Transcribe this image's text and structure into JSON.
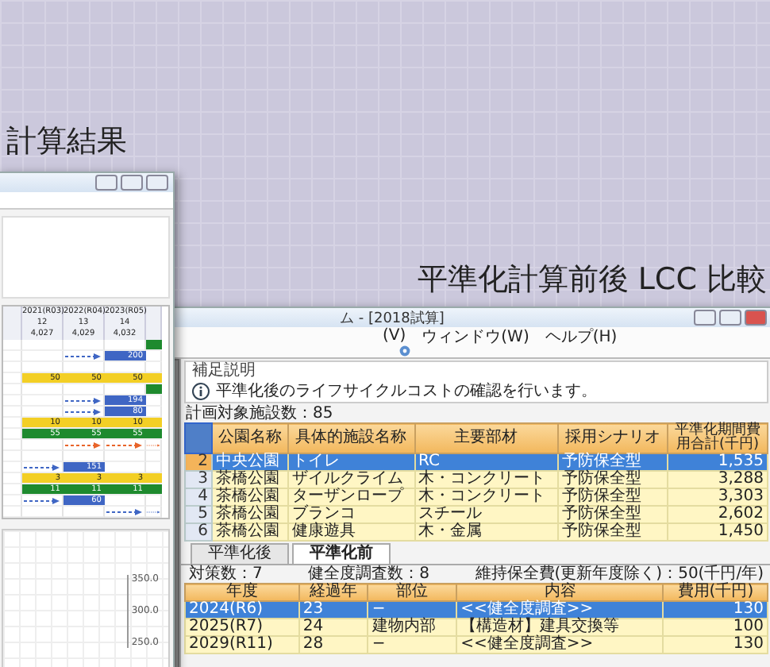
{
  "left_caption": "計算結果",
  "right_caption": "平準化計算前後 LCC 比較",
  "left_window": {
    "grid": {
      "columns": [
        "2021(R03)",
        "2022(R04)",
        "2023(R05)"
      ],
      "column_numbers": [
        "12",
        "13",
        "14"
      ],
      "column_totals": [
        "4,027",
        "4,029",
        "4,032"
      ],
      "rows": [
        {
          "cells": [
            {
              "kind": "empty"
            },
            {
              "kind": "empty"
            },
            {
              "kind": "empty"
            },
            {
              "kind": "done"
            }
          ]
        },
        {
          "cells": [
            {
              "kind": "empty"
            },
            {
              "kind": "arrow"
            },
            {
              "kind": "bar",
              "text": "200"
            },
            {
              "kind": "empty"
            }
          ]
        },
        {
          "cells": [
            {
              "kind": "empty"
            },
            {
              "kind": "empty"
            },
            {
              "kind": "empty"
            },
            {
              "kind": "empty"
            }
          ]
        },
        {
          "cells": [
            {
              "kind": "plan",
              "text": "50"
            },
            {
              "kind": "plan",
              "text": "50"
            },
            {
              "kind": "plan",
              "text": "50"
            },
            {
              "kind": "plan"
            }
          ]
        },
        {
          "cells": [
            {
              "kind": "empty"
            },
            {
              "kind": "empty"
            },
            {
              "kind": "empty"
            },
            {
              "kind": "done"
            }
          ]
        },
        {
          "cells": [
            {
              "kind": "empty"
            },
            {
              "kind": "arrow"
            },
            {
              "kind": "bar",
              "text": "194"
            },
            {
              "kind": "empty"
            }
          ]
        },
        {
          "cells": [
            {
              "kind": "empty"
            },
            {
              "kind": "arrow"
            },
            {
              "kind": "bar",
              "text": "80"
            },
            {
              "kind": "empty"
            }
          ]
        },
        {
          "cells": [
            {
              "kind": "plan",
              "text": "10"
            },
            {
              "kind": "plan",
              "text": "10"
            },
            {
              "kind": "plan",
              "text": "10"
            },
            {
              "kind": "plan"
            }
          ]
        },
        {
          "cells": [
            {
              "kind": "done",
              "text": "55"
            },
            {
              "kind": "done",
              "text": "55"
            },
            {
              "kind": "done",
              "text": "55"
            },
            {
              "kind": "done"
            }
          ]
        },
        {
          "cells": [
            {
              "kind": "empty"
            },
            {
              "kind": "late"
            },
            {
              "kind": "late"
            },
            {
              "kind": "late"
            }
          ]
        },
        {
          "cells": [
            {
              "kind": "empty"
            },
            {
              "kind": "empty"
            },
            {
              "kind": "empty"
            },
            {
              "kind": "empty"
            }
          ]
        },
        {
          "cells": [
            {
              "kind": "arrow"
            },
            {
              "kind": "bar",
              "text": "151"
            },
            {
              "kind": "empty"
            },
            {
              "kind": "empty"
            }
          ]
        },
        {
          "cells": [
            {
              "kind": "plan",
              "text": "3"
            },
            {
              "kind": "plan",
              "text": "3"
            },
            {
              "kind": "plan",
              "text": "3"
            },
            {
              "kind": "plan"
            }
          ]
        },
        {
          "cells": [
            {
              "kind": "done",
              "text": "11"
            },
            {
              "kind": "done",
              "text": "11"
            },
            {
              "kind": "done",
              "text": "11"
            },
            {
              "kind": "done"
            }
          ]
        },
        {
          "cells": [
            {
              "kind": "arrow"
            },
            {
              "kind": "bar",
              "text": "60"
            },
            {
              "kind": "empty"
            },
            {
              "kind": "empty"
            }
          ]
        },
        {
          "cells": [
            {
              "kind": "empty"
            },
            {
              "kind": "empty"
            },
            {
              "kind": "arrow"
            },
            {
              "kind": "arrow"
            }
          ]
        }
      ]
    },
    "chart": {
      "tick_labels": [
        "350.0",
        "300.0",
        "250.0"
      ]
    }
  },
  "right_window": {
    "title": "ム - [2018試算]",
    "menu": [
      "(V)",
      "ウィンドウ(W)",
      "ヘルプ(H)"
    ],
    "note_header": "補足説明",
    "note_text": "平準化後のライフサイクルコストの確認を行います。",
    "facility_count": "計画対象施設数：85",
    "table": {
      "columns": [
        "公園名称",
        "具体的施設名称",
        "主要部材",
        "採用シナリオ",
        "平準化期間費用合計(千円)"
      ],
      "rows": [
        {
          "no": "2",
          "cells": [
            "中央公園",
            "トイレ",
            "RC",
            "予防保全型",
            "1,535"
          ],
          "selected": true
        },
        {
          "no": "3",
          "cells": [
            "茶橋公園",
            "ザイルクライム",
            "木・コンクリート",
            "予防保全型",
            "3,288"
          ],
          "selected": false
        },
        {
          "no": "4",
          "cells": [
            "茶橋公園",
            "ターザンロープ",
            "木・コンクリート",
            "予防保全型",
            "3,303"
          ],
          "selected": false
        },
        {
          "no": "5",
          "cells": [
            "茶橋公園",
            "ブランコ",
            "スチール",
            "予防保全型",
            "2,602"
          ],
          "selected": false
        },
        {
          "no": "6",
          "cells": [
            "茶橋公園",
            "健康遊具",
            "木・金属",
            "予防保全型",
            "1,450"
          ],
          "selected": false
        }
      ]
    },
    "tabs": [
      {
        "label": "平準化後",
        "selected": false
      },
      {
        "label": "平準化前",
        "selected": true
      }
    ],
    "stats": [
      "対策数：7",
      "健全度調査数：8",
      "維持保全費(更新年度除く)：50(千円/年)"
    ],
    "plan_table": {
      "columns": [
        "年度",
        "経過年",
        "部位",
        "内容",
        "費用(千円)"
      ],
      "rows": [
        {
          "cells": [
            "2024(R6)",
            "23",
            "−",
            "<<健全度調査>>",
            "130"
          ],
          "selected": true
        },
        {
          "cells": [
            "2025(R7)",
            "24",
            "建物内部",
            "【構造材】建具交換等",
            "100"
          ],
          "selected": false
        },
        {
          "cells": [
            "2029(R11)",
            "28",
            "−",
            "<<健全度調査>>",
            "130"
          ],
          "selected": false
        }
      ]
    }
  }
}
